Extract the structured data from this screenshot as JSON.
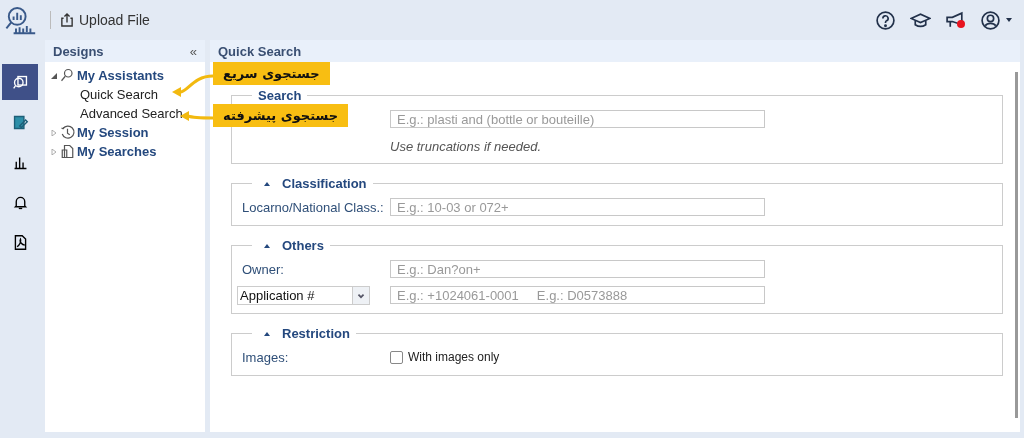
{
  "topbar": {
    "upload_label": "Upload File",
    "icons": [
      {
        "kind": "help"
      },
      {
        "kind": "cap"
      },
      {
        "kind": "megaphone",
        "alert": true
      },
      {
        "kind": "user"
      }
    ]
  },
  "rail": [
    {
      "kind": "search",
      "selected": true
    },
    {
      "kind": "edit",
      "selected": false
    },
    {
      "kind": "chart",
      "selected": false
    },
    {
      "kind": "bell",
      "selected": false
    },
    {
      "kind": "pdf",
      "selected": false
    }
  ],
  "sidebar": {
    "title": "Designs",
    "collapse": "«",
    "tree": [
      {
        "label": "My Assistants",
        "expanded": true,
        "children": [
          {
            "label": "Quick Search"
          },
          {
            "label": "Advanced Search"
          }
        ]
      },
      {
        "label": "My Session",
        "expanded": false
      },
      {
        "label": "My Searches",
        "expanded": false
      }
    ]
  },
  "main": {
    "title": "Quick Search",
    "sections": [
      {
        "legend": "Search",
        "rows": [
          {
            "kind": "field",
            "placeholder": "E.g.: plasti and (bottle or bouteille)"
          },
          {
            "kind": "hint",
            "text": "Use truncations if needed."
          }
        ]
      },
      {
        "legend": "Classification",
        "rows": [
          {
            "kind": "field",
            "label": "Locarno/National Class.:",
            "placeholder": "E.g.: 10-03 or 072+"
          }
        ]
      },
      {
        "legend": "Others",
        "rows": [
          {
            "kind": "field",
            "label": "Owner:",
            "placeholder": "E.g.: Dan?on+"
          },
          {
            "kind": "select",
            "value": "Application #",
            "placeholder": "E.g.: +1024061-0001     E.g.: D0573888"
          }
        ]
      },
      {
        "legend": "Restriction",
        "rows": [
          {
            "kind": "checkbox",
            "label": "Images:",
            "text": "With images only",
            "checked": false
          }
        ]
      }
    ]
  },
  "annotations": [
    {
      "text": "جستجوی سریع"
    },
    {
      "text": "جستجوی پیشرفته"
    }
  ]
}
